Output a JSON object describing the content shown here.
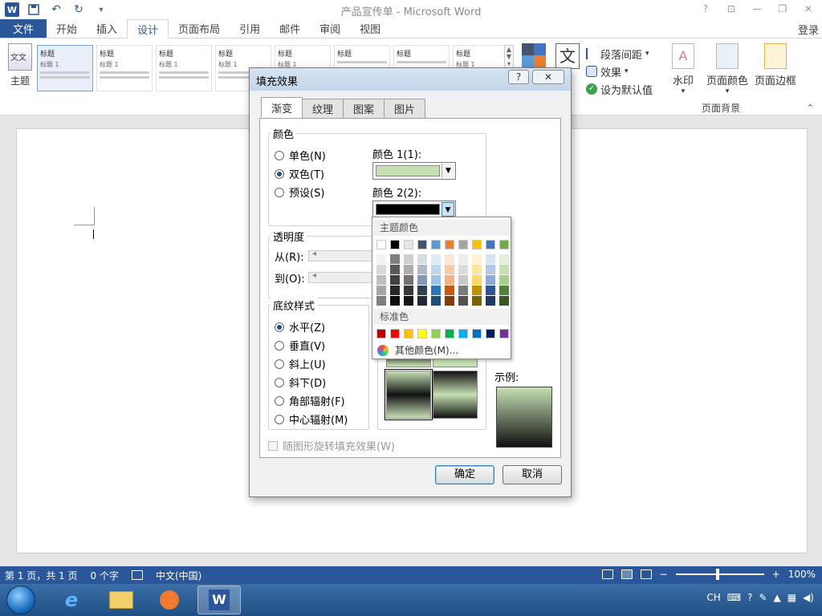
{
  "window": {
    "title": "产品宣传单 - Microsoft Word",
    "logo": "W",
    "controls": [
      "?",
      "⊡",
      "—",
      "❐",
      "✕"
    ]
  },
  "ribbon": {
    "file_tab": "文件",
    "tabs": [
      "开始",
      "插入",
      "设计",
      "页面布局",
      "引用",
      "邮件",
      "审阅",
      "视图"
    ],
    "active_tab": "设计",
    "login": "登录",
    "theme_label": "主题",
    "style_gallery": [
      {
        "title": "标题",
        "sub": "标题 1"
      },
      {
        "title": "标题",
        "sub": "标题 1"
      },
      {
        "title": "标题",
        "sub": "标题 1"
      },
      {
        "title": "标题",
        "sub": "标题 1"
      },
      {
        "title": "标题",
        "sub": "标题 1"
      },
      {
        "title": "标题",
        "sub": ""
      },
      {
        "title": "标题",
        "sub": ""
      },
      {
        "title": "标题",
        "sub": "标题 1"
      }
    ],
    "fonts_glyph": "文",
    "paragraph_spacing": "段落间距",
    "effects": "效果",
    "set_default": "设为默认值",
    "watermark": "水印",
    "page_color": "页面颜色",
    "page_border": "页面边框",
    "group_page_background": "页面背景"
  },
  "status": {
    "page": "第 1 页，共 1 页",
    "words": "0 个字",
    "language": "中文(中国)",
    "zoom": "100%",
    "zoom_minus": "−",
    "zoom_plus": "+"
  },
  "taskbar": {
    "tray_lang": "CH"
  },
  "dialog": {
    "title": "填充效果",
    "help": "?",
    "close": "✕",
    "tabs": [
      "渐变",
      "纹理",
      "图案",
      "图片"
    ],
    "active_tab": "渐变",
    "colors_group": "颜色",
    "color_options": [
      {
        "label": "单色(N)",
        "selected": false
      },
      {
        "label": "双色(T)",
        "selected": true
      },
      {
        "label": "预设(S)",
        "selected": false
      }
    ],
    "color1_label": "颜色 1(1):",
    "color1_value": "#c6e0b4",
    "color2_label": "颜色 2(2):",
    "color2_value": "#000000",
    "transparency_group": "透明度",
    "from_label": "从(R):",
    "to_label": "到(O):",
    "shading_group": "底纹样式",
    "shading_options": [
      {
        "label": "水平(Z)",
        "selected": true
      },
      {
        "label": "垂直(V)",
        "selected": false
      },
      {
        "label": "斜上(U)",
        "selected": false
      },
      {
        "label": "斜下(D)",
        "selected": false
      },
      {
        "label": "角部辐射(F)",
        "selected": false
      },
      {
        "label": "中心辐射(M)",
        "selected": false
      }
    ],
    "sample_label": "示例:",
    "rotate_checkbox": "随图形旋转填充效果(W)",
    "ok": "确定",
    "cancel": "取消"
  },
  "palette": {
    "theme_colors_label": "主题颜色",
    "standard_colors_label": "标准色",
    "more_colors": "其他颜色(M)...",
    "theme_colors": [
      "#ffffff",
      "#000000",
      "#e7e6e6",
      "#44546a",
      "#5b9bd5",
      "#ed7d31",
      "#a5a5a5",
      "#ffc000",
      "#4472c4",
      "#70ad47"
    ],
    "shade_columns": [
      [
        "#f2f2f2",
        "#d9d9d9",
        "#bfbfbf",
        "#a6a6a6",
        "#808080"
      ],
      [
        "#7f7f7f",
        "#595959",
        "#404040",
        "#262626",
        "#0d0d0d"
      ],
      [
        "#d0cece",
        "#afabab",
        "#767171",
        "#3a3838",
        "#171616"
      ],
      [
        "#d6dce4",
        "#adb9ca",
        "#8497b0",
        "#333f4f",
        "#222a35"
      ],
      [
        "#deebf6",
        "#bdd7ee",
        "#9dc3e6",
        "#2e75b5",
        "#1f4e79"
      ],
      [
        "#fbe5d5",
        "#f7cbac",
        "#f4b183",
        "#c55a11",
        "#843c0b"
      ],
      [
        "#ededed",
        "#dbdbdb",
        "#c9c9c9",
        "#7b7b7b",
        "#525252"
      ],
      [
        "#fff2cc",
        "#fee599",
        "#ffd965",
        "#bf9000",
        "#7f6000"
      ],
      [
        "#dae3f3",
        "#b4c7e7",
        "#8eaadb",
        "#2f5496",
        "#1f3864"
      ],
      [
        "#e2efd9",
        "#c5e0b3",
        "#a8d08d",
        "#538135",
        "#375623"
      ]
    ],
    "standard_colors": [
      "#c00000",
      "#ff0000",
      "#ffc000",
      "#ffff00",
      "#92d050",
      "#00b050",
      "#00b0f0",
      "#0070c0",
      "#002060",
      "#7030a0"
    ]
  }
}
